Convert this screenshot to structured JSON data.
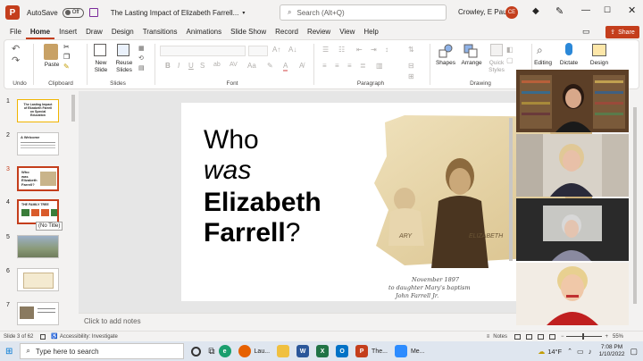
{
  "titlebar": {
    "autosave_label": "AutoSave",
    "autosave_state": "Off",
    "doc_title": "The Lasting Impact of Elizabeth Farrell...",
    "search_placeholder": "Search (Alt+Q)",
    "user_name": "Crowley, E Paula",
    "user_initials": "CE"
  },
  "menu": {
    "tabs": [
      "File",
      "Home",
      "Insert",
      "Draw",
      "Design",
      "Transitions",
      "Animations",
      "Slide Show",
      "Record",
      "Review",
      "View",
      "Help"
    ],
    "active": "Home",
    "share_label": "Share"
  },
  "ribbon": {
    "undo_label": "Undo",
    "clipboard_label": "Clipboard",
    "paste_label": "Paste",
    "new_slide_label": "New Slide",
    "reuse_slides_label": "Reuse Slides",
    "slides_label": "Slides",
    "font_label": "Font",
    "paragraph_label": "Paragraph",
    "shapes_label": "Shapes",
    "arrange_label": "Arrange",
    "quick_styles_label": "Quick Styles",
    "drawing_label": "Drawing",
    "editing_label": "Editing",
    "dictate_label": "Dictate",
    "design_label": "Design"
  },
  "thumbnails": {
    "numbers": [
      "1",
      "2",
      "3",
      "4",
      "5",
      "6",
      "7"
    ],
    "tooltip": "(No Title)",
    "thumb1_text": "The Lasting Impact of Elizabeth Farrell on Special Education",
    "thumb2_text": "A Welcome"
  },
  "slide": {
    "line1": "Who",
    "line2": "was",
    "line3": "Elizabeth",
    "line4": "Farrell",
    "line4_mark": "?",
    "caption1": "November 1897",
    "caption2": "to daughter Mary's baptism",
    "caption3": "John Farrell Jr.",
    "photo_label_left": "ARY",
    "photo_label_right": "ELIZABETH"
  },
  "notes": {
    "placeholder": "Click to add notes"
  },
  "status": {
    "slide_info": "Slide 3 of 62",
    "accessibility": "Accessibility: Investigate",
    "notes_button": "Notes",
    "zoom": "55%"
  },
  "taskbar": {
    "search_placeholder": "Type here to search",
    "app_lau": "Lau...",
    "app_the": "The...",
    "app_me": "Me...",
    "weather": "14°F",
    "time": "7:08 PM",
    "date": "1/10/2022"
  },
  "colors": {
    "accent": "#c43e1c",
    "ribbon_bg": "#ffffff",
    "app_bg": "#f3f2f1"
  }
}
